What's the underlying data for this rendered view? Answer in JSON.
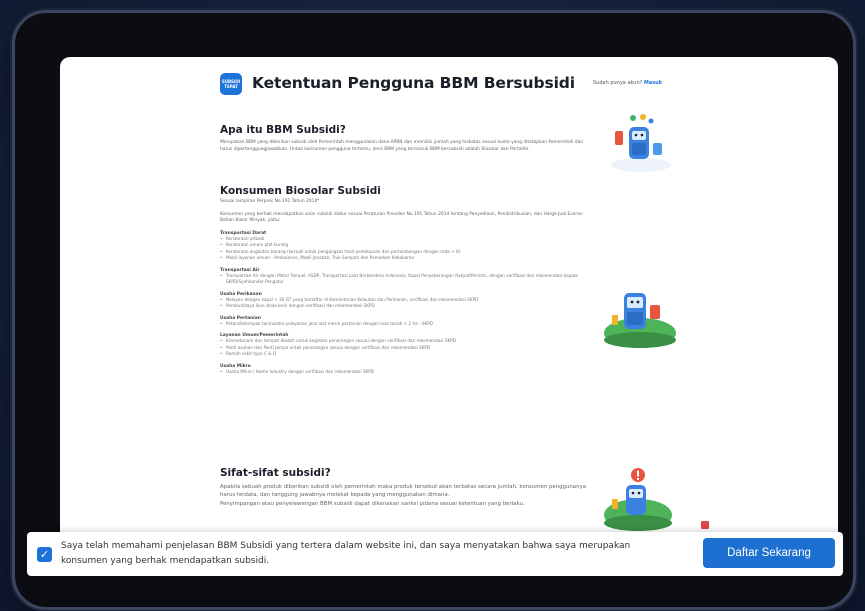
{
  "header": {
    "logo_text": "SUBSIDI TEPAT",
    "title": "Ketentuan Pengguna BBM Bersubsidi",
    "login_prompt": "Sudah punya akun?",
    "login_link": "Masuk"
  },
  "sections": {
    "apa": {
      "title": "Apa itu BBM Subsidi?",
      "body": "Merupakan BBM yang diberikan subsidi oleh Pemerintah menggunakan dana APBN dan memiliki jumlah yang terbatas sesuai kuota yang ditetapkan Pemerintah dan harus dipertanggungjawabkan. Untuk konsumen pengguna tertentu, jenis BBM yang termasuk BBM bersubsidi adalah Biosolar dan Pertalite."
    },
    "konsumen": {
      "title": "Konsumen Biosolar Subsidi",
      "subtitle": "Sesuai lampiran Perpres No.191 Tahun 2014*",
      "intro": "Konsumen yang berhak mendapatkan solar subsidi diatur sesuai Peraturan Presiden No.191 Tahun 2014 tentang Penyediaan, Pendistribusian, dan Harga Jual Eceran Bahan Bakar Minyak, yaitu:",
      "groups": [
        {
          "title": "Transportasi Darat",
          "items": [
            "Kendaraan pribadi",
            "Kendaraan umum plat kuning",
            "Kendaraan angkutan barang (kecuali untuk pengangkut hasil perkebunan dan pertambangan dengan roda > 6)",
            "Mobil layanan umum - Ambulance, Mobil Jenazah, Truk Sampah dan Pemadam Kebakaran"
          ]
        },
        {
          "title": "Transportasi Air",
          "items": [
            "Transportasi Air dengan Motor Tempel, ASDP, Transportasi Laut Berbendera Indonesia, Kapal Penyeberangan Rakyat/Perintis, dengan verifikasi dan rekomendasi kepala SKPD/Syahbandar Pengatur"
          ]
        },
        {
          "title": "Usaha Perikanan",
          "items": [
            "Nelayan dengan kapal < 30 GT yang terdaftar di Kementerian Kelautan dan Perikanan, verifikasi dan rekomendasi SKPD",
            "Pembudidaya ikan skala kecil dengan verifikasi dan rekomendasi SKPD"
          ]
        },
        {
          "title": "Usaha Pertanian",
          "items": [
            "Petani/kelompok tani/usaha pelayanan jasa alat mesin pertanian dengan luas tanah < 2 ha - SKPD"
          ]
        },
        {
          "title": "Layanan Umum/Pemerintah",
          "items": [
            "Krematorium dan tempat ibadah untuk kegiatan penerangan sesuai dengan verifikasi dan rekomendasi SKPD",
            "Panti asuhan dan Panti Jompo untuk penerangan sesuai dengan verifikasi dan rekomendasi SKPD",
            "Rumah sakit type C & D"
          ]
        },
        {
          "title": "Usaha Mikro",
          "items": [
            "Usaha Mikro / Home Industry dengan verifikasi dan rekomendasi SKPD"
          ]
        }
      ]
    },
    "sifat": {
      "title": "Sifat-sifat subsidi?",
      "body1": "Apabila sebuah produk diberikan subsidi oleh pemerintah maka produk tersebut akan terbatas secara jumlah, konsumen penggunanya harus terdata, dan tanggung jawabnya melekat kepada yang menggunakan dimana.",
      "body2": "Penyimpangan atau penyelewengan BBM subsidi dapat dikenakan sanksi pidana sesuai ketentuan yang berlaku."
    }
  },
  "consent": {
    "checkbox_checked": true,
    "text": "Saya telah memahami penjelasan BBM Subsidi yang tertera dalam website ini, dan saya menyatakan bahwa saya merupakan konsumen yang berhak mendapatkan subsidi.",
    "button_label": "Daftar Sekarang"
  },
  "colors": {
    "accent": "#1d6fd0",
    "background": "#16233f",
    "device_frame": "#0c0d12"
  }
}
